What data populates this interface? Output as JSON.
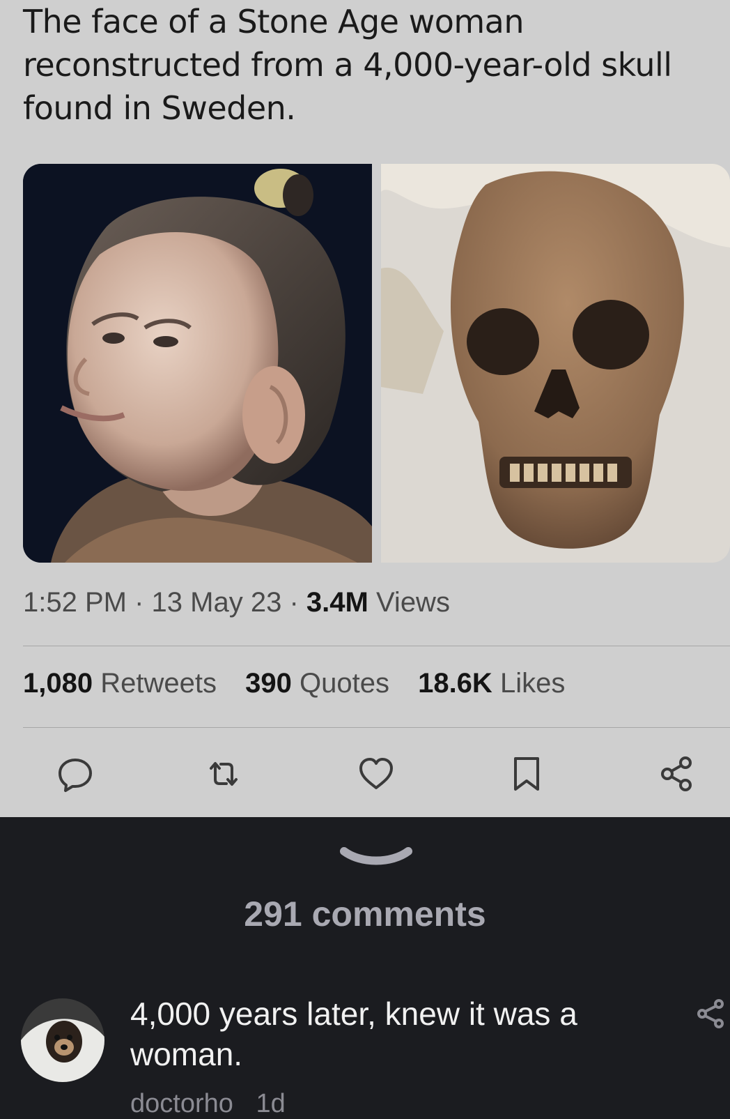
{
  "tweet": {
    "text": "The face of a Stone Age woman reconstructed from a 4,000-year-old skull found in Sweden.",
    "time": "1:52 PM",
    "date": "13 May 23",
    "views_count": "3.4M",
    "views_label": "Views",
    "separator": "·",
    "stats": {
      "retweets_count": "1,080",
      "retweets_label": "Retweets",
      "quotes_count": "390",
      "quotes_label": "Quotes",
      "likes_count": "18.6K",
      "likes_label": "Likes"
    },
    "actions": [
      "reply-icon",
      "retweet-icon",
      "like-icon",
      "bookmark-icon",
      "share-icon"
    ]
  },
  "thread": {
    "comments_count": "291 comments",
    "comment": {
      "text": "4,000 years later, knew it was a woman.",
      "author": "doctorho",
      "age": "1d"
    }
  },
  "colors": {
    "tweet_bg": "#cfcfcf",
    "comments_bg": "#1b1c20",
    "text_dark": "#1a1a1a",
    "text_muted": "#4a4a4a"
  }
}
